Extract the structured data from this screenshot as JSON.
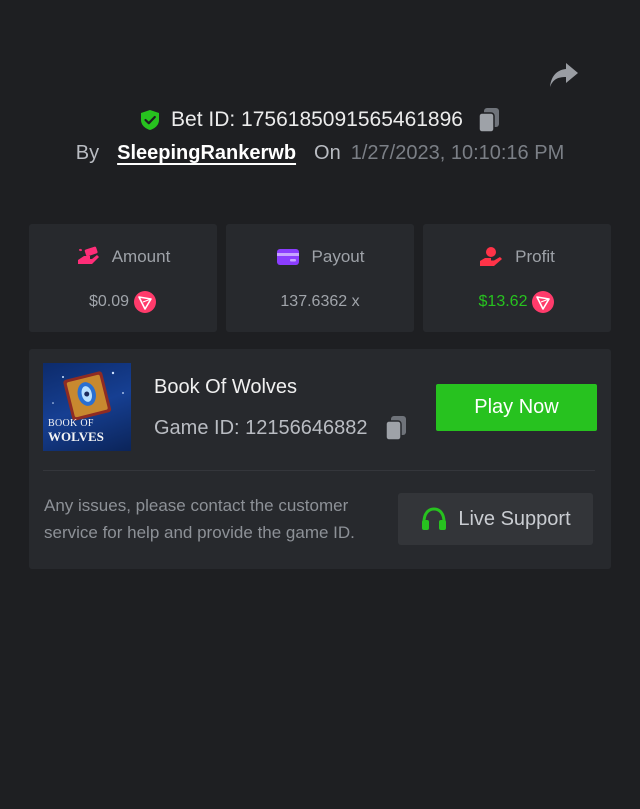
{
  "header": {
    "bet_id_label": "Bet ID: 1756185091565461896",
    "by_label": "By",
    "username": "SleepingRankerwb",
    "on_label": "On",
    "datetime": "1/27/2023, 10:10:16 PM"
  },
  "icons": {
    "share": "share-arrow-icon",
    "verified": "shield-check-icon",
    "copy": "copy-icon",
    "amount": "money-hand-icon",
    "payout": "wallet-card-icon",
    "profit": "profit-hand-icon",
    "coin": "tron-coin-icon",
    "support": "headset-icon"
  },
  "colors": {
    "background": "#1e1f22",
    "card": "#27292d",
    "accent_green": "#27c21f",
    "amount_pink": "#ff2d78",
    "payout_purple": "#8b3dff",
    "profit_red": "#ff3348"
  },
  "stats": {
    "amount": {
      "label": "Amount",
      "value": "$0.09"
    },
    "payout": {
      "label": "Payout",
      "value": "137.6362 x"
    },
    "profit": {
      "label": "Profit",
      "value": "$13.62"
    }
  },
  "game": {
    "title": "Book Of Wolves",
    "id_label": "Game ID: 12156646882",
    "thumb_line1": "BOOK OF",
    "thumb_line2": "WOLVES",
    "play_label": "Play Now",
    "issue_text": "Any issues, please contact the customer service for help and provide the game ID.",
    "support_label": "Live Support"
  }
}
